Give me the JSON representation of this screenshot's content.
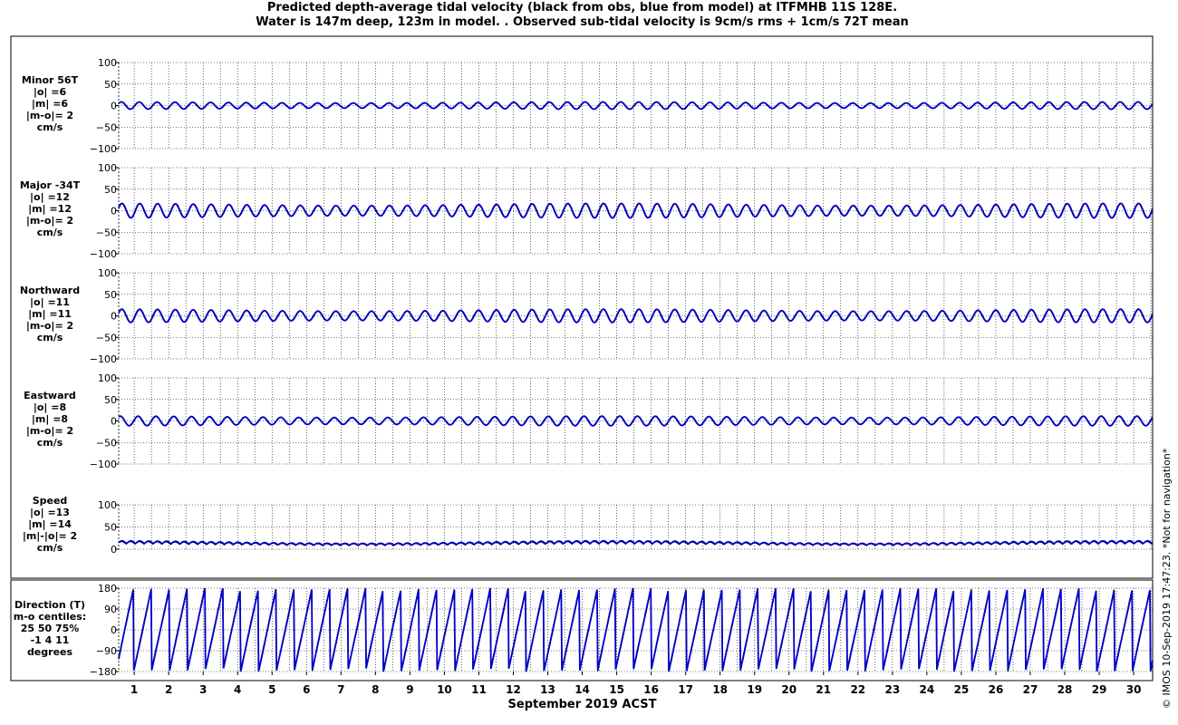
{
  "title_line1": "Predicted depth-average tidal velocity (black from obs, blue from model) at ITFMHB 11S 128E.",
  "title_line2": "Water is 147m deep, 123m in model. . Observed sub-tidal velocity is 9cm/s rms + 1cm/s 72T mean",
  "credit": "© IMOS 10-Sep-2019 17:47:23. *Not for navigation*",
  "colors": {
    "obs": "#000000",
    "model": "#0000cc",
    "grid": "#000000"
  },
  "chart_data": [
    {
      "type": "line",
      "name": "minor",
      "label": [
        "Minor 56T",
        "|o| =6",
        "|m| =6",
        "|m-o|= 2",
        "cm/s"
      ],
      "ylim": [
        -100,
        100
      ],
      "yticks": [
        -100,
        -50,
        0,
        50,
        100
      ],
      "ytick_labels": [
        "−100",
        "−50",
        "0",
        "50",
        "100"
      ],
      "amplitude_obs": 6,
      "amplitude_model": 6,
      "diff": 2,
      "unit": "cm/s"
    },
    {
      "type": "line",
      "name": "major",
      "label": [
        "Major -34T",
        "|o| =12",
        "|m| =12",
        "|m-o|= 2",
        "cm/s"
      ],
      "ylim": [
        -100,
        100
      ],
      "yticks": [
        -100,
        -50,
        0,
        50,
        100
      ],
      "ytick_labels": [
        "−100",
        "−50",
        "0",
        "50",
        "100"
      ],
      "amplitude_obs": 12,
      "amplitude_model": 12,
      "diff": 2,
      "unit": "cm/s"
    },
    {
      "type": "line",
      "name": "northward",
      "label": [
        "Northward",
        "|o| =11",
        "|m| =11",
        "|m-o|= 2",
        "cm/s"
      ],
      "ylim": [
        -100,
        100
      ],
      "yticks": [
        -100,
        -50,
        0,
        50,
        100
      ],
      "ytick_labels": [
        "−100",
        "−50",
        "0",
        "50",
        "100"
      ],
      "amplitude_obs": 11,
      "amplitude_model": 11,
      "diff": 2,
      "unit": "cm/s"
    },
    {
      "type": "line",
      "name": "eastward",
      "label": [
        "Eastward",
        "|o| =8",
        "|m| =8",
        "|m-o|= 2",
        "cm/s"
      ],
      "ylim": [
        -100,
        100
      ],
      "yticks": [
        -100,
        -50,
        0,
        50,
        100
      ],
      "ytick_labels": [
        "−100",
        "−50",
        "0",
        "50",
        "100"
      ],
      "amplitude_obs": 8,
      "amplitude_model": 8,
      "diff": 2,
      "unit": "cm/s"
    },
    {
      "type": "line",
      "name": "speed",
      "label": [
        "Speed",
        "|o| =13",
        "|m| =14",
        "|m|-|o|= 2",
        "cm/s"
      ],
      "ylim": [
        0,
        100
      ],
      "yticks": [
        0,
        50,
        100
      ],
      "ytick_labels": [
        "0",
        "50",
        "100"
      ],
      "amplitude_obs": 13,
      "amplitude_model": 14,
      "diff": 2,
      "unit": "cm/s"
    },
    {
      "type": "line",
      "name": "direction",
      "label": [
        "Direction (T)",
        "m-o centiles:",
        "25  50  75%",
        "-1   4  11",
        "degrees"
      ],
      "ylim": [
        -180,
        180
      ],
      "yticks": [
        -180,
        -90,
        0,
        90,
        180
      ],
      "ytick_labels": [
        "−180",
        "−90",
        "0",
        "90",
        "180"
      ],
      "centiles_pct": [
        25,
        50,
        75
      ],
      "centiles_deg": [
        -1,
        4,
        11
      ],
      "unit": "degrees"
    }
  ],
  "x_axis": {
    "title": "September 2019 ACST",
    "days": [
      1,
      2,
      3,
      4,
      5,
      6,
      7,
      8,
      9,
      10,
      11,
      12,
      13,
      14,
      15,
      16,
      17,
      18,
      19,
      20,
      21,
      22,
      23,
      24,
      25,
      26,
      27,
      28,
      29,
      30
    ],
    "xlim": [
      0.55,
      30.55
    ]
  }
}
